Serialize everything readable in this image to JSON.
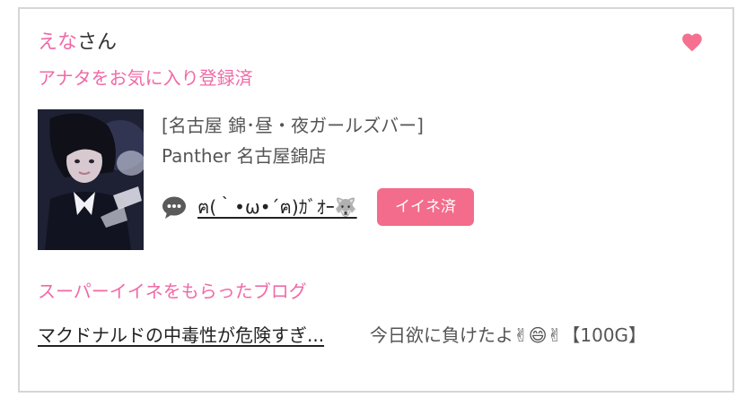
{
  "profile": {
    "name": "えな",
    "name_suffix": "さん",
    "favorite_status": "アナタをお気に入り登録済"
  },
  "shop": {
    "genre": "[名古屋 錦･昼・夜ガールズバー]",
    "name": "Panther 名古屋錦店"
  },
  "comment": {
    "text": "ฅ(｀•ω•´ฅ)ｶﾞｵｰ🐺"
  },
  "ine_badge": {
    "label": "イイネ済"
  },
  "super_ine": {
    "title": "スーパーイイネをもらったブログ",
    "blogs": [
      {
        "title": "マクドナルドの中毒性が危険すぎ..."
      },
      {
        "title": "今日欲に負けたよ✌😄✌【100G】"
      }
    ]
  },
  "colors": {
    "accent_pink": "#f06aa7",
    "badge_pink": "#f36c8b",
    "heart_pink": "#f5708f"
  },
  "icons": {
    "heart": "heart-icon",
    "comment": "speech-bubble-icon"
  }
}
